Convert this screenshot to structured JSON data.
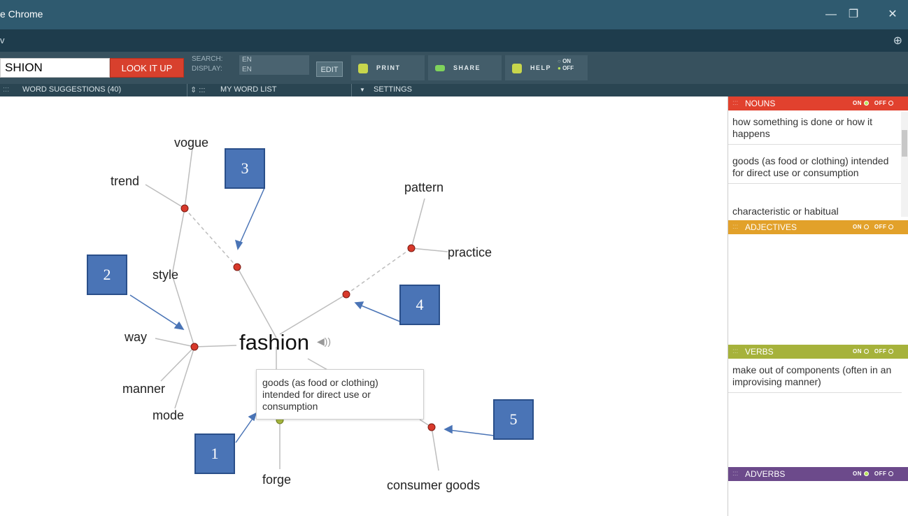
{
  "window": {
    "title": "e Chrome",
    "controls": {
      "minimize": "—",
      "restore": "❐",
      "close": "✕"
    }
  },
  "address": {
    "text": "v",
    "zoom_icon": "⊕"
  },
  "toolbar": {
    "search_value": "SHION",
    "lookup_label": "LOOK IT UP",
    "search_label": "SEARCH:",
    "search_lang": "EN",
    "display_label": "DISPLAY:",
    "display_lang": "EN",
    "edit_label": "EDIT",
    "print_label": "PRINT",
    "share_label": "SHARE",
    "help_label": "HELP",
    "on_label": "ON",
    "off_label": "OFF"
  },
  "tabs": {
    "suggestions": "WORD SUGGESTIONS (40)",
    "wordlist": "MY WORD LIST",
    "settings": "SETTINGS"
  },
  "graph": {
    "center": "fashion",
    "words": {
      "vogue": "vogue",
      "trend": "trend",
      "style": "style",
      "way": "way",
      "manner": "manner",
      "mode": "mode",
      "pattern": "pattern",
      "practice": "practice",
      "forge": "forge",
      "consumer_goods": "consumer goods"
    },
    "tooltip": "goods (as food or clothing) intended for direct use or consumption",
    "callouts": [
      "1",
      "2",
      "3",
      "4",
      "5"
    ],
    "colors": {
      "meaning_node": "#d8392b",
      "verb_node": "#a8b83e",
      "edge": "#bdbdbd"
    }
  },
  "panel": {
    "nouns": {
      "title": "NOUNS",
      "color": "#e1412e",
      "definitions": [
        "how something is done or how it happens",
        "goods (as food or clothing) intended for direct use or consumption",
        "characteristic or habitual"
      ]
    },
    "adjectives": {
      "title": "ADJECTIVES",
      "color": "#e2a12a"
    },
    "verbs": {
      "title": "VERBS",
      "color": "#a6b23b",
      "definitions": [
        "make out of components (often in an improvising manner)"
      ]
    },
    "adverbs": {
      "title": "ADVERBS",
      "color": "#6c4a8b"
    },
    "toggle_on": "ON",
    "toggle_off": "OFF"
  }
}
